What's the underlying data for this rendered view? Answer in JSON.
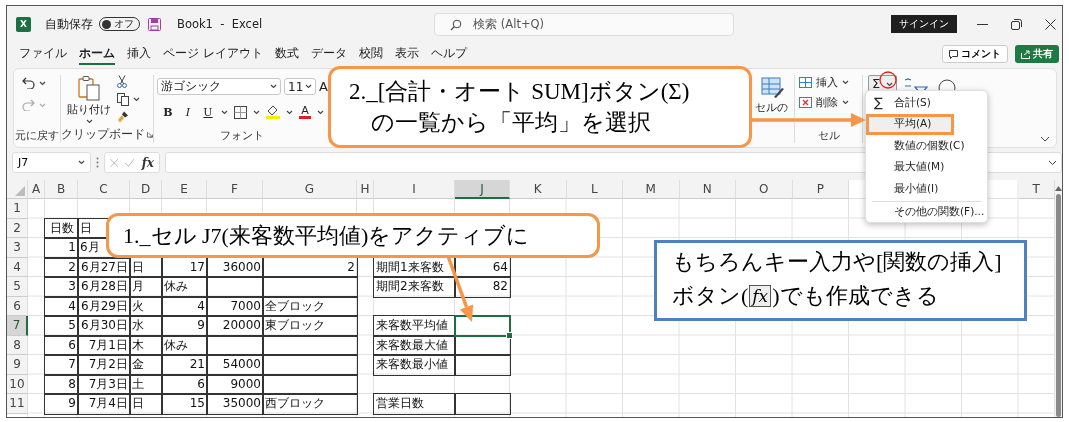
{
  "title_bar": {
    "logo": "X",
    "autosave_label": "自動保存",
    "autosave": {
      "on": false,
      "label": "オフ"
    },
    "title": "Book1  -  Excel",
    "search": {
      "placeholder": "検索 (Alt+Q)"
    },
    "sign_in": "サインイン"
  },
  "menu_tabs": [
    {
      "label": "ファイル",
      "selected": false
    },
    {
      "label": "ホーム",
      "selected": true
    },
    {
      "label": "挿入",
      "selected": false
    },
    {
      "label": "ページ レイアウト",
      "selected": false
    },
    {
      "label": "数式",
      "selected": false
    },
    {
      "label": "データ",
      "selected": false
    },
    {
      "label": "校閲",
      "selected": false
    },
    {
      "label": "表示",
      "selected": false
    },
    {
      "label": "ヘルプ",
      "selected": false
    }
  ],
  "comment_button": "コメント",
  "share_button": "共有",
  "ribbon": {
    "undo_group": {
      "label": "元に戻す"
    },
    "clipboard_group": {
      "paste": "貼り付け",
      "label": "クリップボード"
    },
    "font_group": {
      "font_name": "游ゴシック",
      "font_size": "11",
      "grow_font": "A",
      "format_buttons": [
        "B",
        "I",
        "U"
      ],
      "font_color": "A",
      "label": "フォント"
    },
    "styles_group": {
      "cell_styles": "セルの"
    },
    "cells_group": {
      "buttons": [
        "挿入",
        "削除"
      ],
      "label": "セル"
    },
    "editing_group": {
      "autosum": "Σ"
    }
  },
  "autosum_menu": {
    "items": [
      {
        "symbol": "∑",
        "label": "合計(S)",
        "selected": false
      },
      {
        "label": "平均(A)",
        "selected": true
      },
      {
        "label": "数値の個数(C)",
        "selected": false
      },
      {
        "label": "最大値(M)",
        "selected": false
      },
      {
        "label": "最小値(I)",
        "selected": false
      }
    ],
    "more": "その他の関数(F)..."
  },
  "formula_bar": {
    "name_box": "J7",
    "fx": "fx"
  },
  "sheet": {
    "columns": [
      {
        "label": "A",
        "selected": false
      },
      {
        "label": "B",
        "selected": false
      },
      {
        "label": "C",
        "selected": false
      },
      {
        "label": "D",
        "selected": false
      },
      {
        "label": "E",
        "selected": false
      },
      {
        "label": "F",
        "selected": false
      },
      {
        "label": "G",
        "selected": false
      },
      {
        "label": "H",
        "selected": false
      },
      {
        "label": "I",
        "selected": false
      },
      {
        "label": "J",
        "selected": true
      },
      {
        "label": "K",
        "selected": false
      },
      {
        "label": "L",
        "selected": false
      },
      {
        "label": "M",
        "selected": false
      },
      {
        "label": "N",
        "selected": false
      },
      {
        "label": "O",
        "selected": false
      },
      {
        "label": "P",
        "selected": false
      },
      null,
      null,
      null,
      {
        "label": "T",
        "selected": false
      }
    ],
    "rows": [
      {
        "label": "1",
        "selected": false,
        "cells": []
      },
      {
        "label": "2",
        "selected": false,
        "cells": [
          null,
          {
            "text": "日数",
            "kind": "center"
          },
          {
            "text": "日",
            "kind": "text"
          }
        ]
      },
      {
        "label": "3",
        "selected": false,
        "cells": [
          null,
          {
            "text": "1",
            "kind": "number"
          },
          {
            "text": "6月",
            "kind": "text"
          }
        ]
      },
      {
        "label": "4",
        "selected": false,
        "cells": [
          null,
          {
            "text": "2",
            "kind": "number"
          },
          {
            "text": "6月27日",
            "kind": "number"
          },
          {
            "text": "日",
            "kind": "text"
          },
          {
            "text": "17",
            "kind": "number"
          },
          {
            "text": "36000",
            "kind": "number"
          },
          {
            "text": "2",
            "kind": "number"
          },
          null,
          {
            "text": "期間1来客数",
            "kind": "text"
          },
          {
            "text": "64",
            "kind": "number"
          }
        ]
      },
      {
        "label": "5",
        "selected": false,
        "cells": [
          null,
          {
            "text": "3",
            "kind": "number"
          },
          {
            "text": "6月28日",
            "kind": "number"
          },
          {
            "text": "月",
            "kind": "text"
          },
          {
            "text": "休み",
            "kind": "text"
          },
          {
            "kind": "empty"
          },
          {
            "kind": "empty"
          },
          null,
          {
            "text": "期間2来客数",
            "kind": "text"
          },
          {
            "text": "82",
            "kind": "number"
          }
        ]
      },
      {
        "label": "6",
        "selected": false,
        "cells": [
          null,
          {
            "text": "4",
            "kind": "number"
          },
          {
            "text": "6月29日",
            "kind": "number"
          },
          {
            "text": "火",
            "kind": "text"
          },
          {
            "text": "4",
            "kind": "number"
          },
          {
            "text": "7000",
            "kind": "number"
          },
          {
            "text": "全ブロック",
            "kind": "text"
          }
        ]
      },
      {
        "label": "7",
        "selected": true,
        "cells": [
          null,
          {
            "text": "5",
            "kind": "number"
          },
          {
            "text": "6月30日",
            "kind": "number"
          },
          {
            "text": "水",
            "kind": "text"
          },
          {
            "text": "9",
            "kind": "number"
          },
          {
            "text": "20000",
            "kind": "number"
          },
          {
            "text": "東ブロック",
            "kind": "text"
          },
          null,
          {
            "text": "来客数平均値",
            "kind": "text"
          },
          {
            "kind": "active"
          }
        ]
      },
      {
        "label": "8",
        "selected": false,
        "cells": [
          null,
          {
            "text": "6",
            "kind": "number"
          },
          {
            "text": "7月1日",
            "kind": "number"
          },
          {
            "text": "木",
            "kind": "text"
          },
          {
            "text": "休み",
            "kind": "text"
          },
          {
            "kind": "empty"
          },
          {
            "kind": "empty"
          },
          null,
          {
            "text": "来客数最大値",
            "kind": "text"
          },
          {
            "kind": "empty"
          }
        ]
      },
      {
        "label": "9",
        "selected": false,
        "cells": [
          null,
          {
            "text": "7",
            "kind": "number"
          },
          {
            "text": "7月2日",
            "kind": "number"
          },
          {
            "text": "金",
            "kind": "text"
          },
          {
            "text": "21",
            "kind": "number"
          },
          {
            "text": "54000",
            "kind": "number"
          },
          {
            "kind": "empty"
          },
          null,
          {
            "text": "来客数最小値",
            "kind": "text"
          },
          {
            "kind": "empty"
          }
        ]
      },
      {
        "label": "10",
        "selected": false,
        "cells": [
          null,
          {
            "text": "8",
            "kind": "number"
          },
          {
            "text": "7月3日",
            "kind": "number"
          },
          {
            "text": "土",
            "kind": "text"
          },
          {
            "text": "6",
            "kind": "number"
          },
          {
            "text": "9000",
            "kind": "number"
          },
          {
            "kind": "empty"
          }
        ]
      },
      {
        "label": "11",
        "selected": false,
        "cells": [
          null,
          {
            "text": "9",
            "kind": "number"
          },
          {
            "text": "7月4日",
            "kind": "number"
          },
          {
            "text": "日",
            "kind": "text"
          },
          {
            "text": "15",
            "kind": "number"
          },
          {
            "text": "35000",
            "kind": "number"
          },
          {
            "text": "西ブロック",
            "kind": "text"
          },
          null,
          {
            "text": "営業日数",
            "kind": "text"
          },
          {
            "kind": "empty"
          }
        ]
      }
    ]
  },
  "callouts": [
    {
      "kind": "step",
      "lines": [
        "2._[合計・オート SUM]ボタン(Σ)",
        "の一覧から「平均」を選択"
      ]
    },
    {
      "kind": "step",
      "lines": [
        "1._セル J7(来客数平均値)をアクティブに"
      ]
    }
  ],
  "note": {
    "line1": "もちろんキー入力や[関数の挿入]",
    "line2_before": "ボタン(",
    "fx": "fx",
    "line2_after": ")でも作成できる"
  }
}
